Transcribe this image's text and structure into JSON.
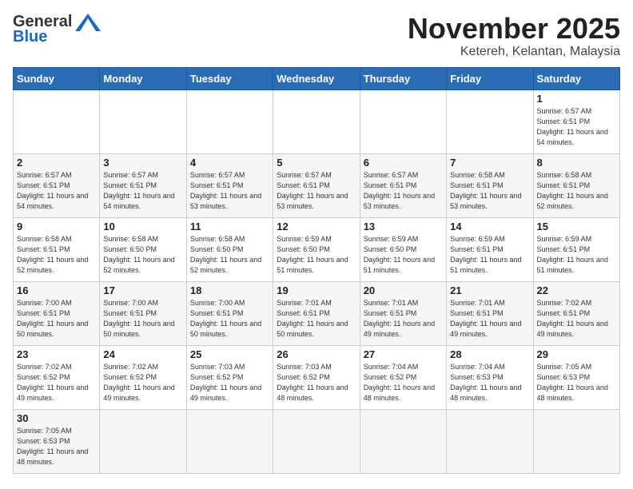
{
  "header": {
    "logo_general": "General",
    "logo_blue": "Blue",
    "month_title": "November 2025",
    "location": "Ketereh, Kelantan, Malaysia"
  },
  "days_of_week": [
    "Sunday",
    "Monday",
    "Tuesday",
    "Wednesday",
    "Thursday",
    "Friday",
    "Saturday"
  ],
  "weeks": [
    [
      {
        "day": "",
        "info": ""
      },
      {
        "day": "",
        "info": ""
      },
      {
        "day": "",
        "info": ""
      },
      {
        "day": "",
        "info": ""
      },
      {
        "day": "",
        "info": ""
      },
      {
        "day": "",
        "info": ""
      },
      {
        "day": "1",
        "info": "Sunrise: 6:57 AM\nSunset: 6:51 PM\nDaylight: 11 hours and 54 minutes."
      }
    ],
    [
      {
        "day": "2",
        "info": "Sunrise: 6:57 AM\nSunset: 6:51 PM\nDaylight: 11 hours and 54 minutes."
      },
      {
        "day": "3",
        "info": "Sunrise: 6:57 AM\nSunset: 6:51 PM\nDaylight: 11 hours and 54 minutes."
      },
      {
        "day": "4",
        "info": "Sunrise: 6:57 AM\nSunset: 6:51 PM\nDaylight: 11 hours and 53 minutes."
      },
      {
        "day": "5",
        "info": "Sunrise: 6:57 AM\nSunset: 6:51 PM\nDaylight: 11 hours and 53 minutes."
      },
      {
        "day": "6",
        "info": "Sunrise: 6:57 AM\nSunset: 6:51 PM\nDaylight: 11 hours and 53 minutes."
      },
      {
        "day": "7",
        "info": "Sunrise: 6:58 AM\nSunset: 6:51 PM\nDaylight: 11 hours and 53 minutes."
      },
      {
        "day": "8",
        "info": "Sunrise: 6:58 AM\nSunset: 6:51 PM\nDaylight: 11 hours and 52 minutes."
      }
    ],
    [
      {
        "day": "9",
        "info": "Sunrise: 6:58 AM\nSunset: 6:51 PM\nDaylight: 11 hours and 52 minutes."
      },
      {
        "day": "10",
        "info": "Sunrise: 6:58 AM\nSunset: 6:50 PM\nDaylight: 11 hours and 52 minutes."
      },
      {
        "day": "11",
        "info": "Sunrise: 6:58 AM\nSunset: 6:50 PM\nDaylight: 11 hours and 52 minutes."
      },
      {
        "day": "12",
        "info": "Sunrise: 6:59 AM\nSunset: 6:50 PM\nDaylight: 11 hours and 51 minutes."
      },
      {
        "day": "13",
        "info": "Sunrise: 6:59 AM\nSunset: 6:50 PM\nDaylight: 11 hours and 51 minutes."
      },
      {
        "day": "14",
        "info": "Sunrise: 6:59 AM\nSunset: 6:51 PM\nDaylight: 11 hours and 51 minutes."
      },
      {
        "day": "15",
        "info": "Sunrise: 6:59 AM\nSunset: 6:51 PM\nDaylight: 11 hours and 51 minutes."
      }
    ],
    [
      {
        "day": "16",
        "info": "Sunrise: 7:00 AM\nSunset: 6:51 PM\nDaylight: 11 hours and 50 minutes."
      },
      {
        "day": "17",
        "info": "Sunrise: 7:00 AM\nSunset: 6:51 PM\nDaylight: 11 hours and 50 minutes."
      },
      {
        "day": "18",
        "info": "Sunrise: 7:00 AM\nSunset: 6:51 PM\nDaylight: 11 hours and 50 minutes."
      },
      {
        "day": "19",
        "info": "Sunrise: 7:01 AM\nSunset: 6:51 PM\nDaylight: 11 hours and 50 minutes."
      },
      {
        "day": "20",
        "info": "Sunrise: 7:01 AM\nSunset: 6:51 PM\nDaylight: 11 hours and 49 minutes."
      },
      {
        "day": "21",
        "info": "Sunrise: 7:01 AM\nSunset: 6:51 PM\nDaylight: 11 hours and 49 minutes."
      },
      {
        "day": "22",
        "info": "Sunrise: 7:02 AM\nSunset: 6:51 PM\nDaylight: 11 hours and 49 minutes."
      }
    ],
    [
      {
        "day": "23",
        "info": "Sunrise: 7:02 AM\nSunset: 6:52 PM\nDaylight: 11 hours and 49 minutes."
      },
      {
        "day": "24",
        "info": "Sunrise: 7:02 AM\nSunset: 6:52 PM\nDaylight: 11 hours and 49 minutes."
      },
      {
        "day": "25",
        "info": "Sunrise: 7:03 AM\nSunset: 6:52 PM\nDaylight: 11 hours and 49 minutes."
      },
      {
        "day": "26",
        "info": "Sunrise: 7:03 AM\nSunset: 6:52 PM\nDaylight: 11 hours and 48 minutes."
      },
      {
        "day": "27",
        "info": "Sunrise: 7:04 AM\nSunset: 6:52 PM\nDaylight: 11 hours and 48 minutes."
      },
      {
        "day": "28",
        "info": "Sunrise: 7:04 AM\nSunset: 6:53 PM\nDaylight: 11 hours and 48 minutes."
      },
      {
        "day": "29",
        "info": "Sunrise: 7:05 AM\nSunset: 6:53 PM\nDaylight: 11 hours and 48 minutes."
      }
    ],
    [
      {
        "day": "30",
        "info": "Sunrise: 7:05 AM\nSunset: 6:53 PM\nDaylight: 11 hours and 48 minutes."
      },
      {
        "day": "",
        "info": ""
      },
      {
        "day": "",
        "info": ""
      },
      {
        "day": "",
        "info": ""
      },
      {
        "day": "",
        "info": ""
      },
      {
        "day": "",
        "info": ""
      },
      {
        "day": "",
        "info": ""
      }
    ]
  ]
}
